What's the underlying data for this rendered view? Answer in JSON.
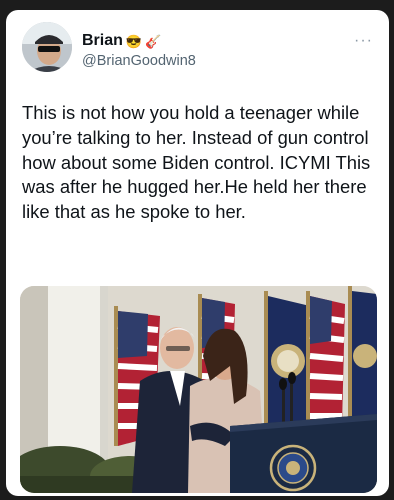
{
  "tweet": {
    "author": {
      "display_name": "Brian",
      "name_emojis": [
        "😎",
        "🎸"
      ],
      "handle": "@BrianGoodwin8",
      "avatar_icon": "user-avatar"
    },
    "more_label": "···",
    "text": "This is not how you hold a teenager while you’re talking to her. Instead of gun control how about some Biden control. ICYMI This was after he hugged her.He held her there like that as he spoke to her.",
    "media": {
      "type": "photo",
      "seal_text": "SEAL OF THE PRESIDENT OF THE UNITED STATES"
    }
  },
  "colors": {
    "background": "#1c1c1c",
    "card": "#ffffff",
    "text": "#0f1419",
    "secondary_text": "#536471",
    "podium": "#1b2a44"
  }
}
